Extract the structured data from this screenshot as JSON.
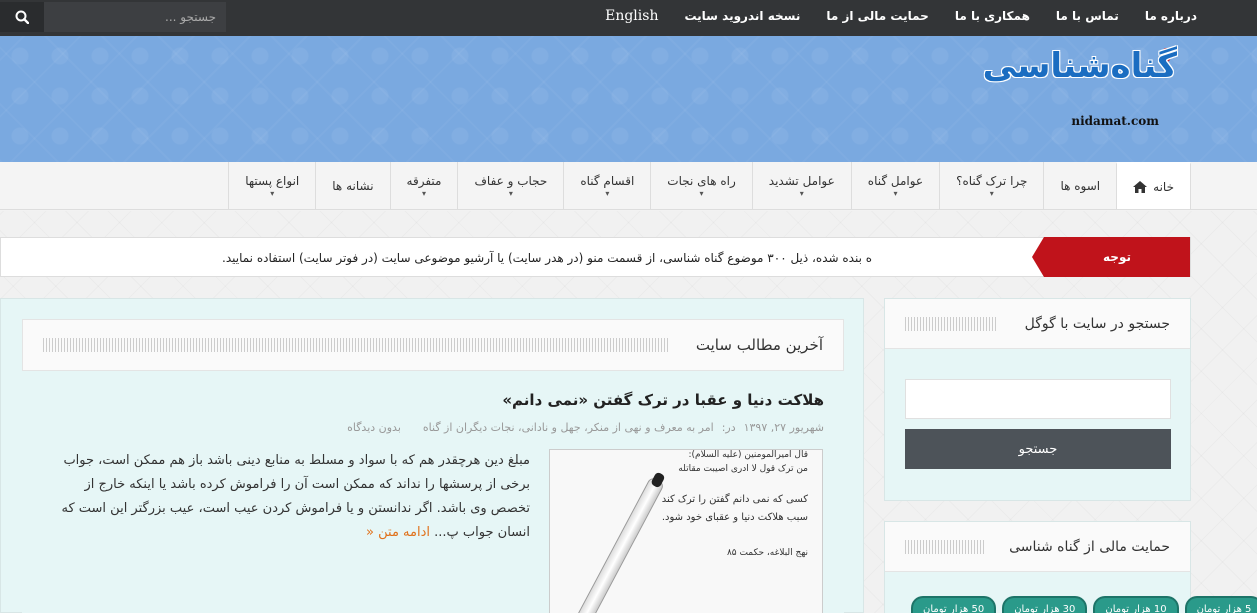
{
  "topbar": {
    "search_placeholder": "جستجو ...",
    "links": [
      "درباره ما",
      "تماس با ما",
      "همکاری با ما",
      "حمایت مالی از ما",
      "نسخه اندروید سایت",
      "English"
    ]
  },
  "header": {
    "logo_text": "گناه‌شناسی",
    "logo_url": "nidamat.com"
  },
  "nav": {
    "items": [
      {
        "label": "خانه",
        "icon": "home-icon",
        "active": true,
        "caret": false
      },
      {
        "label": "اسوه ها",
        "caret": false
      },
      {
        "label": "چرا ترک گناه؟",
        "caret": true
      },
      {
        "label": "عوامل گناه",
        "caret": true
      },
      {
        "label": "عوامل تشدید",
        "caret": true
      },
      {
        "label": "راه های نجات",
        "caret": true
      },
      {
        "label": "اقسام گناه",
        "caret": true
      },
      {
        "label": "حجاب و عفاف",
        "caret": true
      },
      {
        "label": "متفرقه",
        "caret": true
      },
      {
        "label": "نشانه ها",
        "caret": false
      },
      {
        "label": "انواع پستها",
        "caret": true
      }
    ]
  },
  "ticker": {
    "label": "توجه",
    "text": "ه بنده شده، ذیل ۳۰۰ موضوع گناه شناسی، از قسمت منو (در هدر سایت) یا آرشیو موضوعی سایت (در فوتر سایت) استفاده نمایید."
  },
  "main": {
    "section_title": "آخرین مطالب سایت",
    "post": {
      "title": "هلاکت دنیا و عقبا در ترک گفتن «نمی دانم»",
      "date": "شهریور ۲۷, ۱۳۹۷",
      "cats_label": "در:",
      "cats": "امر به معرف و نهی از منکر، جهل و نادانی، نجات دیگران از گناه",
      "comments": "بدون دیدگاه",
      "excerpt": "مبلغ دین هرچقدر هم که با سواد و مسلط به منابع دینی باشد باز هم ممکن است، جواب برخی از پرسشها را نداند که ممکن است آن را فراموش کرده باشد یا اینکه خارج از تخصص وی باشد. اگر ندانستن و یا فراموش کردن عیب است، عیب بزرگتر این است که انسان جواب پ...",
      "read_more": "ادامه متن",
      "image_lines": [
        "قال امیرالمومنین (علیه السلام):",
        "من ترک قول لا ادری اصیبت مقاتله",
        "کسی که نمی دانم گفتن را ترک کند",
        "سبب هلاکت دنیا و عقبای خود شود.",
        "نهج البلاغه، حکمت ۸۵"
      ]
    }
  },
  "sidebar": {
    "google_title": "جستجو در سایت با گوگل",
    "google_button": "جستجو",
    "donate_title": "حمایت مالی از گناه شناسی",
    "donate_buttons": [
      "5 هزار تومان",
      "10 هزار تومان",
      "30 هزار تومان",
      "50 هزار تومان"
    ]
  }
}
